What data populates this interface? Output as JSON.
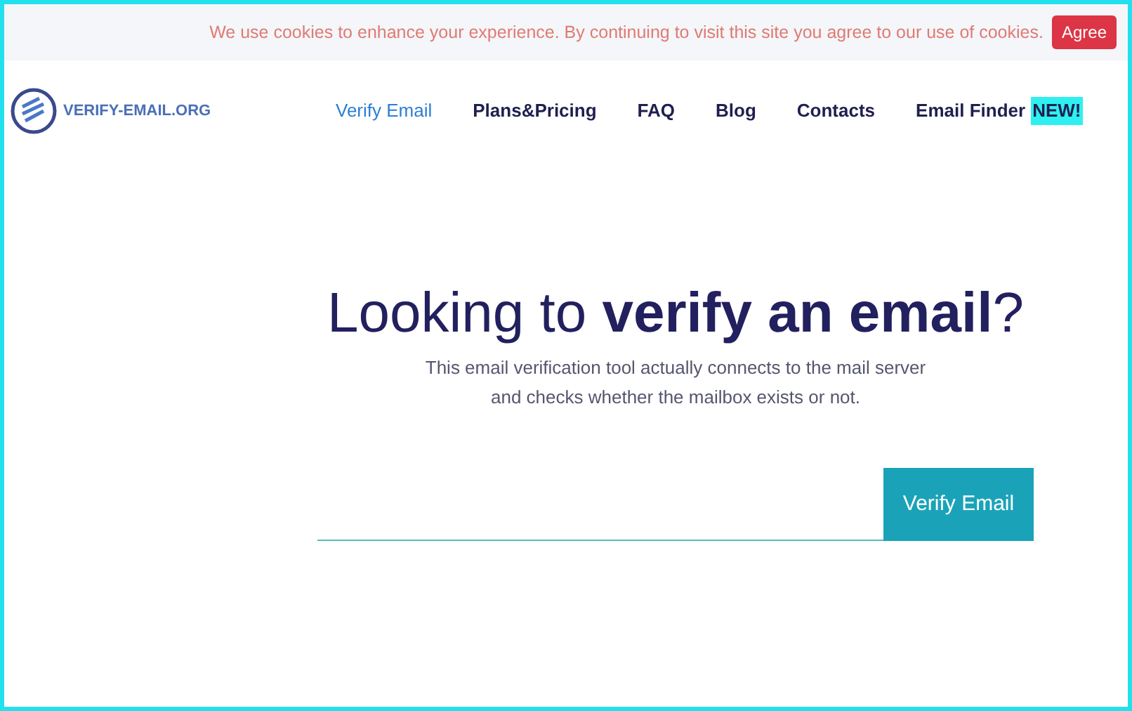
{
  "cookie_bar": {
    "message": "We use cookies to enhance your experience. By continuing to visit this site you agree to our use of cookies.",
    "button": "Agree"
  },
  "logo": {
    "text": "VERIFY-EMAIL.ORG"
  },
  "nav": [
    {
      "label": "Verify Email",
      "selected": true
    },
    {
      "label": "Plans&Pricing",
      "selected": false
    },
    {
      "label": "FAQ",
      "selected": false
    },
    {
      "label": "Blog",
      "selected": false
    },
    {
      "label": "Contacts",
      "selected": false
    },
    {
      "label": "Email Finder",
      "selected": false,
      "badge": "NEW!"
    }
  ],
  "hero": {
    "title": "Looking to **verify an email**?",
    "subtitle_lines": [
      "This email verification tool actually connects to the mail server",
      "and checks whether the mailbox exists or not."
    ]
  },
  "form": {
    "button": "Verify Email"
  }
}
